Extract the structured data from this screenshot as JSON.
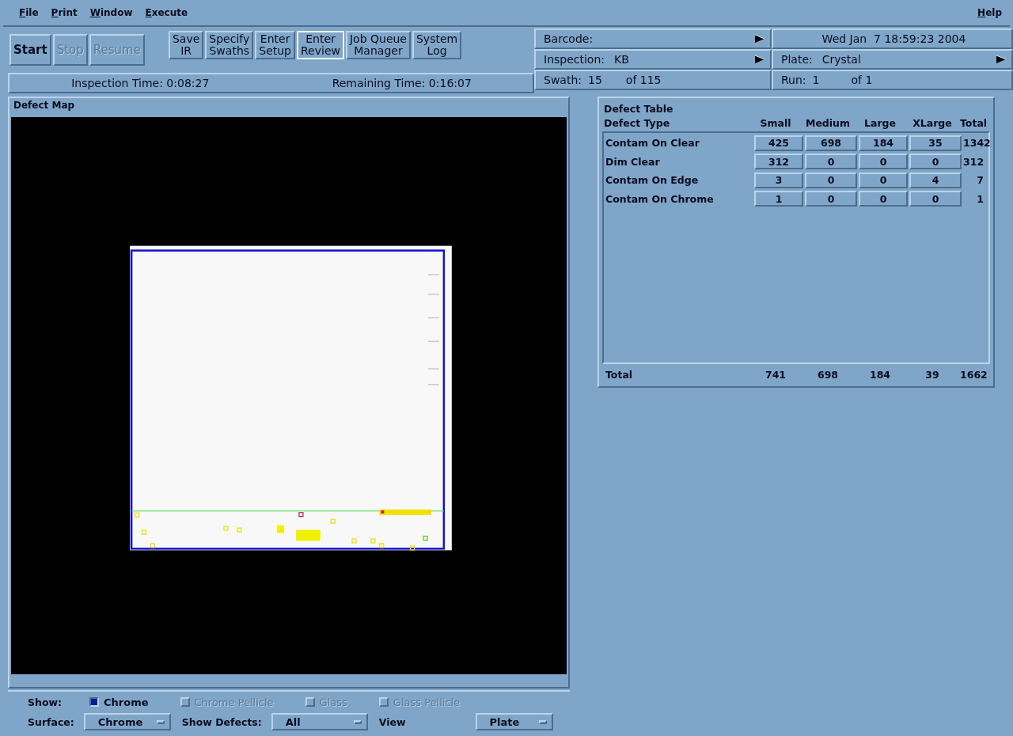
{
  "menu": {
    "items": [
      "File",
      "Print",
      "Window",
      "Execute"
    ],
    "help": "Help"
  },
  "toolbar": {
    "run_buttons": [
      {
        "label": "Start",
        "disabled": false,
        "focused": false
      },
      {
        "label": "Stop",
        "disabled": true,
        "focused": false
      },
      {
        "label": "Resume",
        "disabled": true,
        "focused": false
      }
    ],
    "action_buttons": [
      {
        "label": "Save\nIR",
        "disabled": false,
        "focused": false
      },
      {
        "label": "Specify\nSwaths",
        "disabled": false,
        "focused": false
      },
      {
        "label": "Enter\nSetup",
        "disabled": false,
        "focused": false
      },
      {
        "label": "Enter\nReview",
        "disabled": false,
        "focused": true
      },
      {
        "label": "Job Queue\nManager",
        "disabled": false,
        "focused": false
      },
      {
        "label": "System\nLog",
        "disabled": false,
        "focused": false
      }
    ]
  },
  "status": {
    "inspection_time": "Inspection Time: 0:08:27",
    "remaining_time": "Remaining Time: 0:16:07"
  },
  "info": {
    "barcode": {
      "label": "Barcode:"
    },
    "date": "Wed Jan  7 18:59:23 2004",
    "inspection": {
      "label": "Inspection:",
      "value": "KB"
    },
    "plate": {
      "label": "Plate:",
      "value": "Crystal"
    },
    "swath": {
      "label": "Swath:",
      "value": "15",
      "total": "of 115"
    },
    "run": {
      "label": "Run:",
      "value": "1",
      "total": "of 1"
    }
  },
  "defect_map": {
    "title": "Defect Map"
  },
  "defect_table": {
    "title": "Defect Table",
    "columns": [
      "Defect Type",
      "Small",
      "Medium",
      "Large",
      "XLarge",
      "Total"
    ],
    "rows": [
      {
        "type": "Contam On Clear",
        "counts": [
          "425",
          "698",
          "184",
          "35"
        ],
        "total": "1342"
      },
      {
        "type": "Dim Clear",
        "counts": [
          "312",
          "0",
          "0",
          "0"
        ],
        "total": "312"
      },
      {
        "type": "Contam On Edge",
        "counts": [
          "3",
          "0",
          "0",
          "4"
        ],
        "total": "7"
      },
      {
        "type": "Contam On Chrome",
        "counts": [
          "1",
          "0",
          "0",
          "0"
        ],
        "total": "1"
      }
    ],
    "total_row": {
      "label": "Total",
      "values": [
        "741",
        "698",
        "184",
        "39",
        "1662"
      ]
    }
  },
  "show": {
    "label": "Show:",
    "options": [
      {
        "label": "Chrome",
        "checked": true,
        "disabled": false
      },
      {
        "label": "Chrome Pellicle",
        "checked": false,
        "disabled": true
      },
      {
        "label": "Glass",
        "checked": false,
        "disabled": true
      },
      {
        "label": "Glass Pellicle",
        "checked": false,
        "disabled": true
      }
    ]
  },
  "dropdowns": [
    {
      "label": "Surface:",
      "value": "Chrome"
    },
    {
      "label": "Show Defects:",
      "value": "All"
    },
    {
      "label": "View",
      "value": "Plate"
    }
  ]
}
